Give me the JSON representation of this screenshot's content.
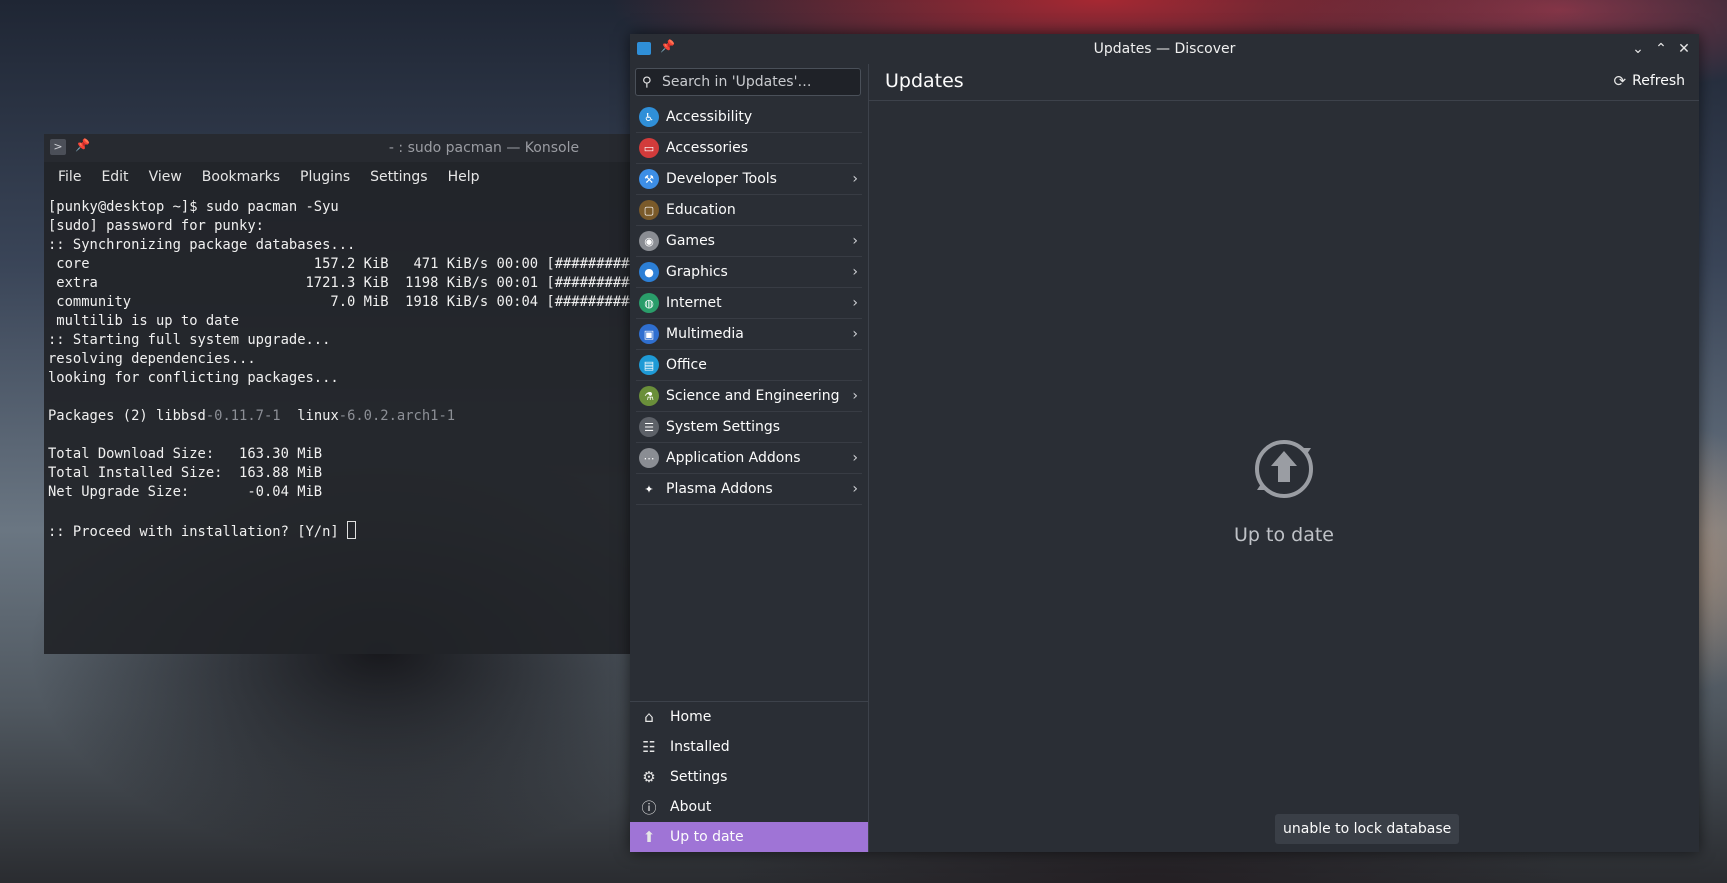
{
  "konsole": {
    "title": "- : sudo pacman — Konsole",
    "menu": [
      "File",
      "Edit",
      "View",
      "Bookmarks",
      "Plugins",
      "Settings",
      "Help"
    ],
    "lines": [
      "[punky@desktop ~]$ sudo pacman -Syu",
      "[sudo] password for punky:",
      ":: Synchronizing package databases...",
      " core                           157.2 KiB   471 KiB/s 00:00 [##########",
      " extra                         1721.3 KiB  1198 KiB/s 00:01 [##########",
      " community                        7.0 MiB  1918 KiB/s 00:04 [##########",
      " multilib is up to date",
      ":: Starting full system upgrade...",
      "resolving dependencies...",
      "looking for conflicting packages...",
      ""
    ],
    "packages_prefix": "Packages (2) ",
    "pkg1_name": "libbsd",
    "pkg1_ver": "-0.11.7-1",
    "pkg2_name": "linux",
    "pkg2_ver": "-6.0.2.arch1-1",
    "lines2": [
      "",
      "Total Download Size:   163.30 MiB",
      "Total Installed Size:  163.88 MiB",
      "Net Upgrade Size:       -0.04 MiB",
      ""
    ],
    "prompt": ":: Proceed with installation? [Y/n] "
  },
  "discover": {
    "title": "Updates — Discover",
    "search_placeholder": "Search in 'Updates'…",
    "categories": [
      {
        "label": "Accessibility",
        "icon": "accessibility-icon",
        "color": "#2f8fd8",
        "sub": false
      },
      {
        "label": "Accessories",
        "icon": "toolbox-icon",
        "color": "#d23b3b",
        "sub": false
      },
      {
        "label": "Developer Tools",
        "icon": "hammer-icon",
        "color": "#3d8ee6",
        "sub": true
      },
      {
        "label": "Education",
        "icon": "chalkboard-icon",
        "color": "#7a5a2a",
        "sub": false
      },
      {
        "label": "Games",
        "icon": "gamepad-icon",
        "color": "#8a8d93",
        "sub": true
      },
      {
        "label": "Graphics",
        "icon": "graphics-icon",
        "color": "#2c7fd6",
        "sub": true
      },
      {
        "label": "Internet",
        "icon": "globe-icon",
        "color": "#2a9d6a",
        "sub": true
      },
      {
        "label": "Multimedia",
        "icon": "monitor-icon",
        "color": "#2f6fd0",
        "sub": true
      },
      {
        "label": "Office",
        "icon": "office-icon",
        "color": "#1e9ad6",
        "sub": false
      },
      {
        "label": "Science and Engineering",
        "icon": "flask-icon",
        "color": "#6a8f3a",
        "sub": true
      },
      {
        "label": "System Settings",
        "icon": "settings-panel-icon",
        "color": "#5d6168",
        "sub": false
      },
      {
        "label": "Application Addons",
        "icon": "dots-icon",
        "color": "#8a8d93",
        "sub": true
      },
      {
        "label": "Plasma Addons",
        "icon": "sparkle-icon",
        "color": "#2a2e35",
        "sub": true
      }
    ],
    "nav": [
      {
        "label": "Home",
        "icon": "home-icon",
        "glyph": "⌂"
      },
      {
        "label": "Installed",
        "icon": "installed-list-icon",
        "glyph": "☷"
      },
      {
        "label": "Settings",
        "icon": "sliders-icon",
        "glyph": "⚙"
      },
      {
        "label": "About",
        "icon": "info-icon",
        "glyph": "ⓘ"
      },
      {
        "label": "Up to date",
        "icon": "update-status-icon",
        "glyph": "⬆"
      }
    ],
    "page_title": "Updates",
    "refresh_label": "Refresh",
    "status_text": "Up to date",
    "toast": "unable to lock database",
    "accent_color": "#9f74d6"
  }
}
